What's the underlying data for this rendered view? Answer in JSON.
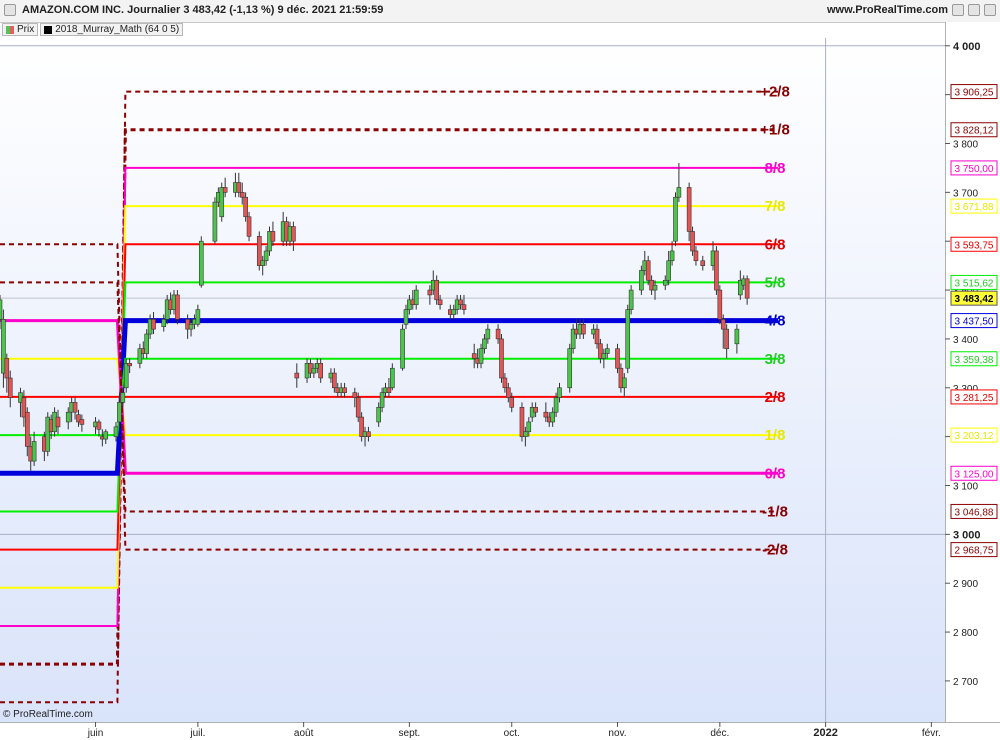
{
  "header": {
    "title": "AMAZON.COM INC. Journalier 3 483,42 (-1,13 %) 9 déc. 2021 21:59:59",
    "site": "www.ProRealTime.com"
  },
  "legend": [
    "Prix",
    "2018_Murray_Math (64 0 5)"
  ],
  "footer": "© ProRealTime.com",
  "chart_data": {
    "type": "candlestick",
    "ylim": [
      2620,
      4020
    ],
    "y_ticks": [
      {
        "v": 4000,
        "label": "4 000",
        "major": true
      },
      {
        "v": 3900,
        "label": "3 900"
      },
      {
        "v": 3800,
        "label": "3 800"
      },
      {
        "v": 3700,
        "label": "3 700"
      },
      {
        "v": 3600,
        "label": "3 600"
      },
      {
        "v": 3500,
        "label": "3 500"
      },
      {
        "v": 3400,
        "label": "3 400"
      },
      {
        "v": 3300,
        "label": "3 300"
      },
      {
        "v": 3200,
        "label": "3 200"
      },
      {
        "v": 3100,
        "label": "3 100"
      },
      {
        "v": 3000,
        "label": "3 000",
        "major": true
      },
      {
        "v": 2900,
        "label": "2 900"
      },
      {
        "v": 2800,
        "label": "2 800"
      },
      {
        "v": 2700,
        "label": "2 700"
      }
    ],
    "x_ticks": [
      {
        "label": "juin",
        "date": "2021-06-01"
      },
      {
        "label": "juil.",
        "date": "2021-07-01"
      },
      {
        "label": "août",
        "date": "2021-08-01"
      },
      {
        "label": "sept.",
        "date": "2021-09-01"
      },
      {
        "label": "oct.",
        "date": "2021-10-01"
      },
      {
        "label": "nov.",
        "date": "2021-11-01"
      },
      {
        "label": "déc.",
        "date": "2021-12-01"
      },
      {
        "label": "2022",
        "date": "2022-01-01",
        "major": true
      },
      {
        "label": "févr.",
        "date": "2022-02-01"
      }
    ],
    "x_range": [
      "2021-05-04",
      "2022-02-05"
    ],
    "switch_date": "2021-06-08",
    "levels": [
      {
        "label": "+2/8",
        "price": 3906.25,
        "price_label": "3 906,25",
        "color": "#8b0000",
        "style": "dash",
        "width": 2,
        "text_color": "#8b0000",
        "old": 2656.25
      },
      {
        "label": "+1/8",
        "price": 3828.12,
        "price_label": "3 828,12",
        "color": "#8b0000",
        "style": "dash",
        "width": 3,
        "text_color": "#8b0000",
        "old": 2734.38
      },
      {
        "label": "8/8",
        "price": 3750.0,
        "price_label": "3 750,00",
        "color": "#ff00cc",
        "style": "solid",
        "width": 2,
        "text_color": "#ff00cc",
        "old": 2812.5
      },
      {
        "label": "7/8",
        "price": 3671.88,
        "price_label": "3 671,88",
        "color": "#ffff00",
        "style": "solid",
        "width": 2,
        "text_color": "#e8e800",
        "old": 2890.62
      },
      {
        "label": "6/8",
        "price": 3593.75,
        "price_label": "3 593,75",
        "color": "#ff0000",
        "style": "solid",
        "width": 2,
        "text_color": "#e00000",
        "old": 2968.75
      },
      {
        "label": "5/8",
        "price": 3515.62,
        "price_label": "3 515,62",
        "color": "#00ee00",
        "style": "solid",
        "width": 2,
        "text_color": "#22cc22",
        "old": 3046.88
      },
      {
        "label": "4/8",
        "price": 3437.5,
        "price_label": "3 437,50",
        "color": "#0000dd",
        "style": "solid",
        "width": 5,
        "text_color": "#0000cc",
        "old": 3125.0
      },
      {
        "label": "3/8",
        "price": 3359.38,
        "price_label": "3 359,38",
        "color": "#00ee00",
        "style": "solid",
        "width": 2,
        "text_color": "#22cc22",
        "old": 3203.12
      },
      {
        "label": "2/8",
        "price": 3281.25,
        "price_label": "3 281,25",
        "color": "#ff0000",
        "style": "solid",
        "width": 2,
        "text_color": "#e00000",
        "old": 3281.25
      },
      {
        "label": "1/8",
        "price": 3203.12,
        "price_label": "3 203,12",
        "color": "#ffff00",
        "style": "solid",
        "width": 2,
        "text_color": "#e8e800",
        "old": 3359.38
      },
      {
        "label": "0/8",
        "price": 3125.0,
        "price_label": "3 125,00",
        "color": "#ff00cc",
        "style": "solid",
        "width": 3,
        "text_color": "#ff00cc",
        "old": 3437.5
      },
      {
        "label": "-1/8",
        "price": 3046.88,
        "price_label": "3 046,88",
        "color": "#8b0000",
        "style": "dash",
        "width": 2,
        "text_color": "#8b0000",
        "old": 3515.62
      },
      {
        "label": "-2/8",
        "price": 2968.75,
        "price_label": "2 968,75",
        "color": "#8b0000",
        "style": "dash",
        "width": 2,
        "text_color": "#8b0000",
        "old": 3593.75
      }
    ],
    "last_price": {
      "value": 3483.42,
      "label": "3 483,42"
    },
    "candles": [
      [
        "2021-05-04",
        3440,
        3480,
        3420,
        3490
      ],
      [
        "2021-05-05",
        3330,
        3440,
        3300,
        3460
      ],
      [
        "2021-05-06",
        3360,
        3320,
        3290,
        3370
      ],
      [
        "2021-05-07",
        3320,
        3280,
        3260,
        3335
      ],
      [
        "2021-05-10",
        3270,
        3290,
        3240,
        3300
      ],
      [
        "2021-05-11",
        3280,
        3240,
        3220,
        3295
      ],
      [
        "2021-05-12",
        3250,
        3180,
        3160,
        3260
      ],
      [
        "2021-05-13",
        3180,
        3150,
        3130,
        3200
      ],
      [
        "2021-05-14",
        3150,
        3190,
        3140,
        3210
      ],
      [
        "2021-05-17",
        3200,
        3170,
        3150,
        3210
      ],
      [
        "2021-05-18",
        3170,
        3240,
        3160,
        3250
      ],
      [
        "2021-05-19",
        3235,
        3210,
        3195,
        3245
      ],
      [
        "2021-05-20",
        3210,
        3250,
        3200,
        3260
      ],
      [
        "2021-05-21",
        3240,
        3220,
        3205,
        3255
      ],
      [
        "2021-05-24",
        3230,
        3250,
        3215,
        3260
      ],
      [
        "2021-05-25",
        3250,
        3270,
        3230,
        3280
      ],
      [
        "2021-05-26",
        3270,
        3250,
        3235,
        3280
      ],
      [
        "2021-05-27",
        3245,
        3230,
        3220,
        3255
      ],
      [
        "2021-05-28",
        3235,
        3225,
        3210,
        3245
      ],
      [
        "2021-06-01",
        3220,
        3230,
        3205,
        3240
      ],
      [
        "2021-06-02",
        3230,
        3215,
        3200,
        3235
      ],
      [
        "2021-06-03",
        3200,
        3195,
        3180,
        3215
      ],
      [
        "2021-06-04",
        3195,
        3210,
        3185,
        3215
      ],
      [
        "2021-06-07",
        3200,
        3220,
        3190,
        3230
      ],
      [
        "2021-06-08",
        3230,
        3270,
        3220,
        3285
      ],
      [
        "2021-06-09",
        3270,
        3290,
        3260,
        3300
      ],
      [
        "2021-06-10",
        3300,
        3350,
        3290,
        3360
      ],
      [
        "2021-06-11",
        3350,
        3345,
        3330,
        3360
      ],
      [
        "2021-06-14",
        3350,
        3380,
        3340,
        3390
      ],
      [
        "2021-06-15",
        3380,
        3370,
        3360,
        3395
      ],
      [
        "2021-06-16",
        3370,
        3410,
        3360,
        3420
      ],
      [
        "2021-06-17",
        3410,
        3440,
        3400,
        3450
      ],
      [
        "2021-06-18",
        3440,
        3420,
        3410,
        3455
      ],
      [
        "2021-06-21",
        3425,
        3440,
        3415,
        3450
      ],
      [
        "2021-06-22",
        3440,
        3480,
        3430,
        3490
      ],
      [
        "2021-06-23",
        3480,
        3460,
        3450,
        3495
      ],
      [
        "2021-06-24",
        3460,
        3490,
        3450,
        3500
      ],
      [
        "2021-06-25",
        3490,
        3440,
        3430,
        3500
      ],
      [
        "2021-06-28",
        3440,
        3420,
        3400,
        3450
      ],
      [
        "2021-06-29",
        3420,
        3430,
        3405,
        3440
      ],
      [
        "2021-06-30",
        3430,
        3440,
        3420,
        3450
      ],
      [
        "2021-07-01",
        3430,
        3460,
        3425,
        3470
      ],
      [
        "2021-07-02",
        3510,
        3600,
        3505,
        3610
      ],
      [
        "2021-07-06",
        3600,
        3680,
        3595,
        3690
      ],
      [
        "2021-07-07",
        3680,
        3700,
        3670,
        3710
      ],
      [
        "2021-07-08",
        3650,
        3710,
        3640,
        3720
      ],
      [
        "2021-07-09",
        3710,
        3700,
        3690,
        3730
      ],
      [
        "2021-07-12",
        3700,
        3720,
        3690,
        3740
      ],
      [
        "2021-07-13",
        3720,
        3700,
        3690,
        3740
      ],
      [
        "2021-07-14",
        3700,
        3690,
        3675,
        3720
      ],
      [
        "2021-07-15",
        3690,
        3650,
        3640,
        3700
      ],
      [
        "2021-07-16",
        3650,
        3610,
        3600,
        3660
      ],
      [
        "2021-07-19",
        3610,
        3550,
        3540,
        3620
      ],
      [
        "2021-07-20",
        3550,
        3560,
        3530,
        3570
      ],
      [
        "2021-07-21",
        3560,
        3580,
        3550,
        3590
      ],
      [
        "2021-07-22",
        3580,
        3620,
        3570,
        3630
      ],
      [
        "2021-07-23",
        3620,
        3600,
        3590,
        3640
      ],
      [
        "2021-07-26",
        3600,
        3640,
        3590,
        3660
      ],
      [
        "2021-07-27",
        3640,
        3600,
        3590,
        3650
      ],
      [
        "2021-07-28",
        3600,
        3630,
        3590,
        3640
      ],
      [
        "2021-07-29",
        3630,
        3600,
        3580,
        3640
      ],
      [
        "2021-07-30",
        3330,
        3320,
        3300,
        3350
      ],
      [
        "2021-08-02",
        3320,
        3350,
        3310,
        3360
      ],
      [
        "2021-08-03",
        3350,
        3330,
        3320,
        3360
      ],
      [
        "2021-08-04",
        3330,
        3340,
        3320,
        3350
      ],
      [
        "2021-08-05",
        3340,
        3350,
        3330,
        3360
      ],
      [
        "2021-08-06",
        3350,
        3320,
        3310,
        3360
      ],
      [
        "2021-08-09",
        3320,
        3330,
        3310,
        3340
      ],
      [
        "2021-08-10",
        3330,
        3300,
        3290,
        3340
      ],
      [
        "2021-08-11",
        3300,
        3290,
        3280,
        3310
      ],
      [
        "2021-08-12",
        3290,
        3300,
        3280,
        3310
      ],
      [
        "2021-08-13",
        3300,
        3290,
        3280,
        3310
      ],
      [
        "2021-08-16",
        3290,
        3280,
        3260,
        3300
      ],
      [
        "2021-08-17",
        3280,
        3240,
        3230,
        3290
      ],
      [
        "2021-08-18",
        3240,
        3200,
        3190,
        3250
      ],
      [
        "2021-08-19",
        3200,
        3210,
        3180,
        3220
      ],
      [
        "2021-08-20",
        3210,
        3200,
        3190,
        3220
      ],
      [
        "2021-08-23",
        3230,
        3260,
        3220,
        3270
      ],
      [
        "2021-08-24",
        3260,
        3290,
        3250,
        3300
      ],
      [
        "2021-08-25",
        3290,
        3300,
        3280,
        3310
      ],
      [
        "2021-08-26",
        3300,
        3290,
        3280,
        3320
      ],
      [
        "2021-08-27",
        3300,
        3340,
        3295,
        3350
      ],
      [
        "2021-08-30",
        3340,
        3420,
        3335,
        3430
      ],
      [
        "2021-08-31",
        3430,
        3460,
        3420,
        3470
      ],
      [
        "2021-09-01",
        3460,
        3480,
        3450,
        3490
      ],
      [
        "2021-09-02",
        3480,
        3470,
        3460,
        3500
      ],
      [
        "2021-09-03",
        3470,
        3500,
        3460,
        3510
      ],
      [
        "2021-09-07",
        3500,
        3490,
        3470,
        3510
      ],
      [
        "2021-09-08",
        3500,
        3520,
        3490,
        3540
      ],
      [
        "2021-09-09",
        3520,
        3480,
        3470,
        3530
      ],
      [
        "2021-09-10",
        3480,
        3470,
        3460,
        3490
      ],
      [
        "2021-09-13",
        3460,
        3450,
        3440,
        3470
      ],
      [
        "2021-09-14",
        3450,
        3460,
        3440,
        3470
      ],
      [
        "2021-09-15",
        3460,
        3480,
        3450,
        3490
      ],
      [
        "2021-09-16",
        3480,
        3470,
        3460,
        3490
      ],
      [
        "2021-09-17",
        3470,
        3460,
        3450,
        3490
      ],
      [
        "2021-09-20",
        3370,
        3360,
        3340,
        3390
      ],
      [
        "2021-09-21",
        3360,
        3350,
        3340,
        3380
      ],
      [
        "2021-09-22",
        3350,
        3380,
        3340,
        3390
      ],
      [
        "2021-09-23",
        3380,
        3400,
        3370,
        3410
      ],
      [
        "2021-09-24",
        3400,
        3420,
        3390,
        3430
      ],
      [
        "2021-09-27",
        3420,
        3400,
        3390,
        3430
      ],
      [
        "2021-09-28",
        3400,
        3320,
        3310,
        3410
      ],
      [
        "2021-09-29",
        3320,
        3300,
        3290,
        3330
      ],
      [
        "2021-09-30",
        3300,
        3280,
        3270,
        3310
      ],
      [
        "2021-10-01",
        3280,
        3260,
        3250,
        3290
      ],
      [
        "2021-10-04",
        3260,
        3200,
        3190,
        3270
      ],
      [
        "2021-10-05",
        3200,
        3210,
        3180,
        3220
      ],
      [
        "2021-10-06",
        3210,
        3230,
        3200,
        3240
      ],
      [
        "2021-10-07",
        3240,
        3260,
        3230,
        3270
      ],
      [
        "2021-10-08",
        3260,
        3250,
        3240,
        3270
      ],
      [
        "2021-10-11",
        3250,
        3240,
        3230,
        3270
      ],
      [
        "2021-10-12",
        3240,
        3230,
        3220,
        3250
      ],
      [
        "2021-10-13",
        3230,
        3250,
        3220,
        3260
      ],
      [
        "2021-10-14",
        3250,
        3280,
        3240,
        3290
      ],
      [
        "2021-10-15",
        3280,
        3300,
        3270,
        3310
      ],
      [
        "2021-10-18",
        3300,
        3380,
        3290,
        3390
      ],
      [
        "2021-10-19",
        3380,
        3420,
        3370,
        3430
      ],
      [
        "2021-10-20",
        3420,
        3410,
        3400,
        3440
      ],
      [
        "2021-10-21",
        3410,
        3430,
        3400,
        3440
      ],
      [
        "2021-10-22",
        3430,
        3410,
        3400,
        3440
      ],
      [
        "2021-10-25",
        3410,
        3420,
        3400,
        3430
      ],
      [
        "2021-10-26",
        3420,
        3390,
        3380,
        3430
      ],
      [
        "2021-10-27",
        3390,
        3360,
        3350,
        3400
      ],
      [
        "2021-10-28",
        3360,
        3370,
        3340,
        3380
      ],
      [
        "2021-10-29",
        3370,
        3380,
        3360,
        3390
      ],
      [
        "2021-11-01",
        3380,
        3340,
        3330,
        3390
      ],
      [
        "2021-11-02",
        3340,
        3300,
        3290,
        3350
      ],
      [
        "2021-11-03",
        3300,
        3320,
        3280,
        3330
      ],
      [
        "2021-11-04",
        3340,
        3460,
        3330,
        3470
      ],
      [
        "2021-11-05",
        3460,
        3500,
        3450,
        3510
      ],
      [
        "2021-11-08",
        3500,
        3540,
        3490,
        3550
      ],
      [
        "2021-11-09",
        3540,
        3560,
        3530,
        3580
      ],
      [
        "2021-11-10",
        3560,
        3520,
        3510,
        3570
      ],
      [
        "2021-11-11",
        3520,
        3500,
        3490,
        3530
      ],
      [
        "2021-11-12",
        3500,
        3510,
        3480,
        3520
      ],
      [
        "2021-11-15",
        3510,
        3520,
        3500,
        3530
      ],
      [
        "2021-11-16",
        3520,
        3560,
        3510,
        3580
      ],
      [
        "2021-11-17",
        3560,
        3580,
        3550,
        3600
      ],
      [
        "2021-11-18",
        3600,
        3690,
        3590,
        3700
      ],
      [
        "2021-11-19",
        3690,
        3710,
        3680,
        3760
      ],
      [
        "2021-11-22",
        3710,
        3620,
        3600,
        3720
      ],
      [
        "2021-11-23",
        3620,
        3580,
        3570,
        3630
      ],
      [
        "2021-11-24",
        3580,
        3560,
        3550,
        3590
      ],
      [
        "2021-11-26",
        3560,
        3550,
        3540,
        3570
      ],
      [
        "2021-11-29",
        3550,
        3580,
        3540,
        3600
      ],
      [
        "2021-11-30",
        3580,
        3500,
        3490,
        3590
      ],
      [
        "2021-12-01",
        3500,
        3440,
        3430,
        3510
      ],
      [
        "2021-12-02",
        3440,
        3420,
        3380,
        3450
      ],
      [
        "2021-12-03",
        3420,
        3380,
        3360,
        3430
      ],
      [
        "2021-12-06",
        3390,
        3420,
        3370,
        3430
      ],
      [
        "2021-12-07",
        3490,
        3520,
        3480,
        3540
      ],
      [
        "2021-12-08",
        3510,
        3523,
        3500,
        3530
      ],
      [
        "2021-12-09",
        3523,
        3483.42,
        3470,
        3530
      ]
    ]
  }
}
